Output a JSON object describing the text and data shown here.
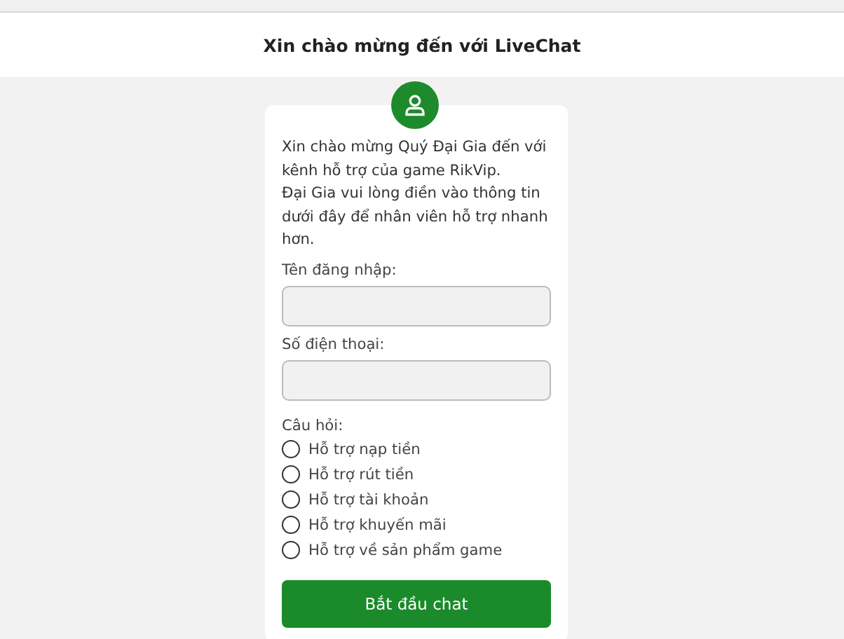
{
  "header": {
    "title": "Xin chào mừng đến với LiveChat"
  },
  "form": {
    "intro": "Xin chào mừng Quý Đại Gia đến với kênh hỗ trợ của game RikVip.\nĐại Gia vui lòng điền vào thông tin dưới đây để nhân viên hỗ trợ nhanh hơn.",
    "fields": [
      {
        "label": "Tên đăng nhập:"
      },
      {
        "label": "Số điện thoại:"
      }
    ],
    "question_label": "Câu hỏi:",
    "options": [
      {
        "label": "Hỗ trợ nạp tiền",
        "selected": false
      },
      {
        "label": "Hỗ trợ rút tiền",
        "selected": false
      },
      {
        "label": "Hỗ trợ tài khoản",
        "selected": false
      },
      {
        "label": "Hỗ trợ khuyến mãi",
        "selected": false
      },
      {
        "label": "Hỗ trợ về sản phẩm game",
        "selected": false
      }
    ],
    "submit": "Bắt đầu chat"
  }
}
